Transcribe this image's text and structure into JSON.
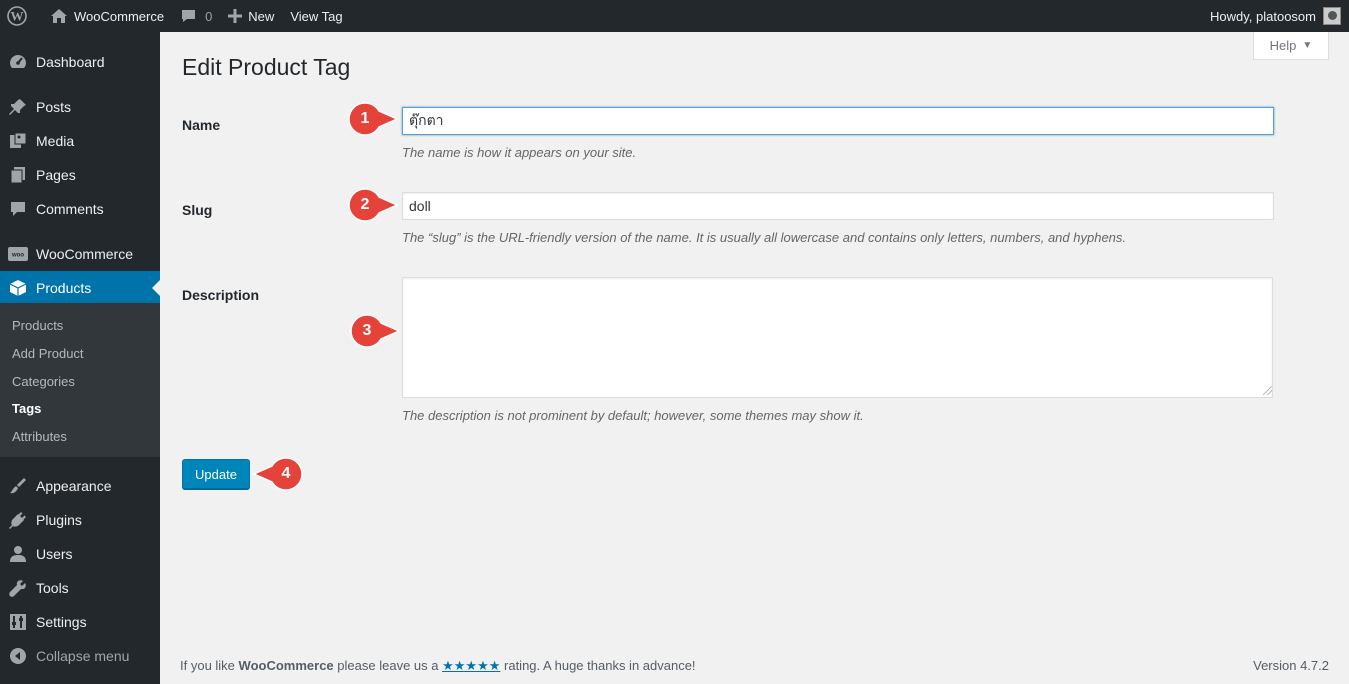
{
  "adminbar": {
    "site_name": "WooCommerce",
    "comments_count": "0",
    "new_label": "New",
    "view_label": "View Tag",
    "greeting": "Howdy, platoosom"
  },
  "sidebar": {
    "items": [
      {
        "label": "Dashboard",
        "icon": "dashboard-icon"
      },
      {
        "label": "Posts",
        "icon": "pushpin-icon"
      },
      {
        "label": "Media",
        "icon": "media-icon"
      },
      {
        "label": "Pages",
        "icon": "pages-icon"
      },
      {
        "label": "Comments",
        "icon": "comment-icon"
      },
      {
        "label": "WooCommerce",
        "icon": "woo-icon"
      },
      {
        "label": "Products",
        "icon": "box-icon"
      },
      {
        "label": "Appearance",
        "icon": "brush-icon"
      },
      {
        "label": "Plugins",
        "icon": "plug-icon"
      },
      {
        "label": "Users",
        "icon": "user-icon"
      },
      {
        "label": "Tools",
        "icon": "wrench-icon"
      },
      {
        "label": "Settings",
        "icon": "settings-icon"
      },
      {
        "label": "Collapse menu",
        "icon": "collapse-icon"
      }
    ],
    "submenu": [
      {
        "label": "Products"
      },
      {
        "label": "Add Product"
      },
      {
        "label": "Categories"
      },
      {
        "label": "Tags"
      },
      {
        "label": "Attributes"
      }
    ]
  },
  "main": {
    "help_label": "Help",
    "title": "Edit Product Tag",
    "name_label": "Name",
    "name_value": "ตุ๊กตา",
    "name_desc": "The name is how it appears on your site.",
    "slug_label": "Slug",
    "slug_value": "doll",
    "slug_desc": "The “slug” is the URL-friendly version of the name. It is usually all lowercase and contains only letters, numbers, and hyphens.",
    "description_label": "Description",
    "description_value": "",
    "description_desc": "The description is not prominent by default; however, some themes may show it.",
    "update_label": "Update"
  },
  "callouts": [
    "1",
    "2",
    "3",
    "4"
  ],
  "footer": {
    "text_before": "If you like",
    "brand": "WooCommerce",
    "text_middle": "please leave us a",
    "stars": "★★★★★",
    "text_after": "rating. A huge thanks in advance!",
    "version": "Version 4.7.2"
  },
  "colors": {
    "adminbar_bg": "#23282d",
    "sidebar_bg": "#23282d",
    "submenu_bg": "#32373c",
    "accent": "#0073aa",
    "button": "#0085ba",
    "callout": "#e5423a"
  }
}
